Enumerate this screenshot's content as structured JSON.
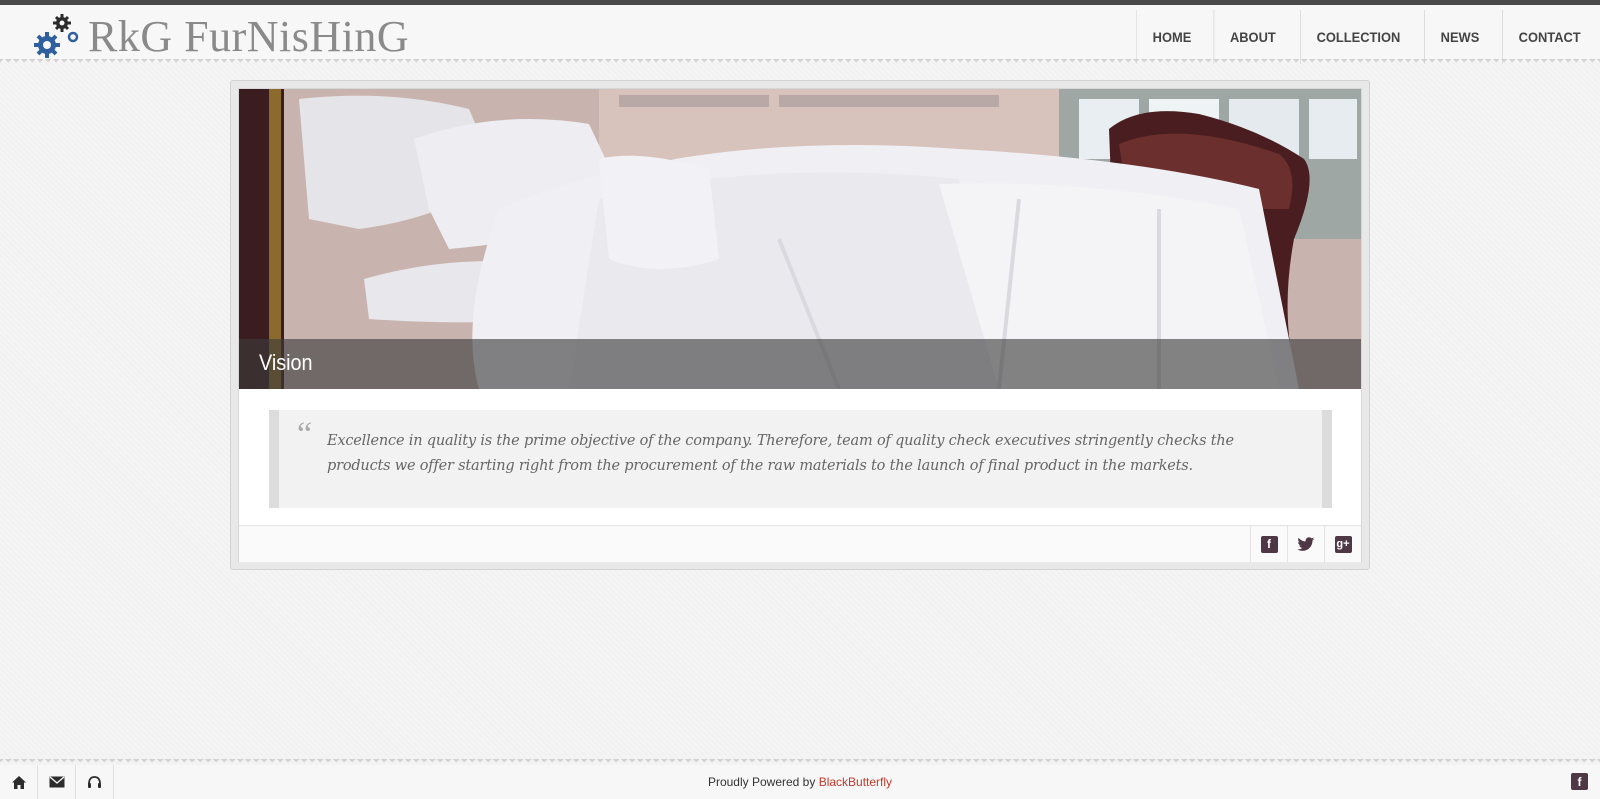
{
  "brand": {
    "logo_text": "RkG FurNisHinG"
  },
  "nav": {
    "items": [
      {
        "label": "HOME"
      },
      {
        "label": "ABOUT"
      },
      {
        "label": "COLLECTION"
      },
      {
        "label": "NEWS"
      },
      {
        "label": "CONTACT"
      }
    ]
  },
  "hero": {
    "caption": "Vision"
  },
  "quote": {
    "mark": "“",
    "text": "Excellence in quality is the prime objective of the company. Therefore, team of quality check executives stringently checks the products we offer starting right from the procurement of the raw materials to the launch of final product in the markets."
  },
  "share": {
    "icons": [
      "facebook-icon",
      "twitter-icon",
      "google-plus-icon"
    ]
  },
  "footer": {
    "powered_prefix": "Proudly Powered by",
    "powered_link": "BlackButterfly",
    "left_icons": [
      "home-icon",
      "mail-icon",
      "headphones-icon"
    ],
    "right_icon": "facebook-icon"
  },
  "colors": {
    "accent": "#c0392b",
    "icon_bg": "#4f3846",
    "top_bar": "#4a4a4a"
  }
}
